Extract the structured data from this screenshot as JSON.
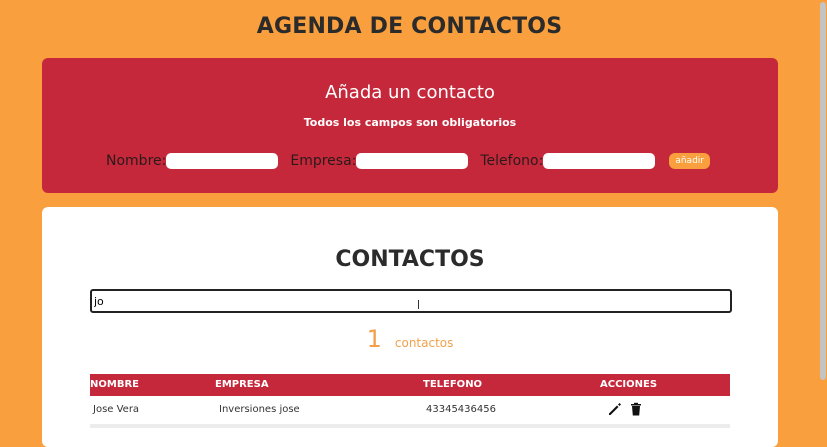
{
  "app": {
    "title": "AGENDA DE CONTACTOS"
  },
  "form": {
    "title": "Añada un contacto",
    "subtitle": "Todos los campos son obligatorios",
    "fields": [
      {
        "label": "Nombre:",
        "value": ""
      },
      {
        "label": "Empresa:",
        "value": ""
      },
      {
        "label": "Telefono:",
        "value": ""
      }
    ],
    "add_button": "añadir"
  },
  "contacts": {
    "title": "CONTACTOS",
    "search_value": "jo",
    "count": "1",
    "count_label": "contactos",
    "columns": [
      "NOMBRE",
      "EMPRESA",
      "TELEFONO",
      "ACCIONES"
    ],
    "rows": [
      {
        "nombre": "Jose Vera",
        "empresa": "Inversiones jose",
        "telefono": "43345436456"
      }
    ]
  },
  "icons": {
    "edit": "pencil-icon",
    "delete": "trash-icon"
  },
  "colors": {
    "background": "#f99f3d",
    "accent": "#c6283b",
    "count": "#f2a14a"
  }
}
